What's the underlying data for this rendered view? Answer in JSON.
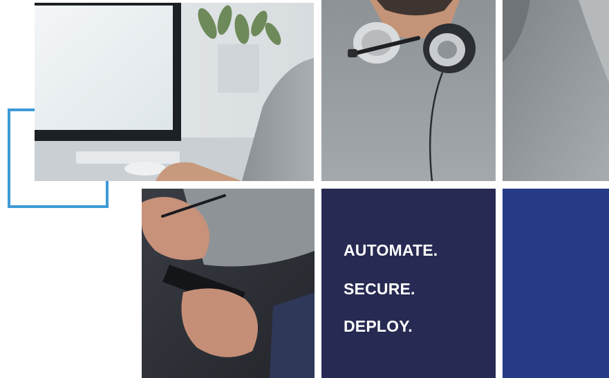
{
  "tagline": {
    "line_1": "AUTOMATE.",
    "line_2": "SECURE.",
    "line_3": "DEPLOY."
  },
  "colors": {
    "accent_bracket": "#3d9ad6",
    "panel_navy": "#272a52",
    "panel_blue": "#263b86"
  },
  "photos": {
    "top_left": "office-desk-monitor-photo",
    "top_middle": "man-with-headset-photo",
    "top_right": "grey-sweater-shoulder-photo",
    "bottom_left": "hands-holding-phone-photo"
  }
}
